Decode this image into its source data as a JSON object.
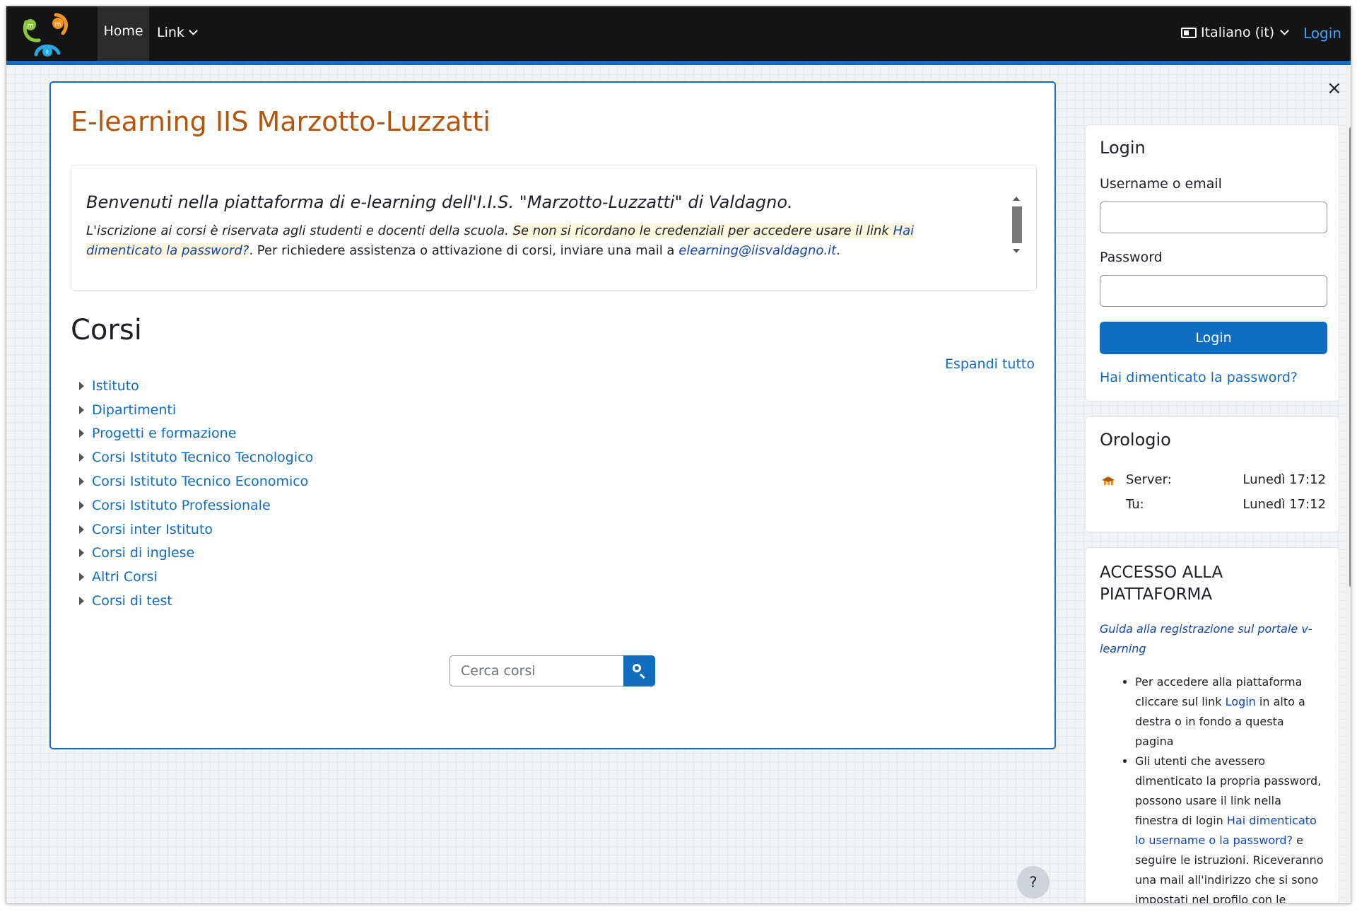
{
  "navbar": {
    "home": "Home",
    "link": "Link",
    "language": "Italiano (it)",
    "login": "Login",
    "logo_letters": [
      "m",
      "m",
      "it"
    ],
    "accent_color": "#0f6cbf"
  },
  "main": {
    "site_title": "E-learning IIS Marzotto-Luzzatti",
    "welcome": {
      "heading": "Benvenuti nella piattaforma di e-learning dell'I.I.S. \"Marzotto-Luzzatti\" di Valdagno.",
      "line1": "L'iscrizione ai corsi è riservata agli studenti e docenti della scuola.",
      "line2": "Se non si ricordano le credenziali per accedere usare il link",
      "forgot_link": "Hai dimenticato la password?",
      "line3": ". Per richiedere assistenza o attivazione di corsi, inviare una mail a",
      "email": "elearning@iisvaldagno.it",
      "line4": "."
    },
    "courses_heading": "Corsi",
    "expand_all": "Espandi tutto",
    "categories": [
      "Istituto",
      "Dipartimenti",
      "Progetti e formazione",
      "Corsi Istituto Tecnico Tecnologico",
      "Corsi Istituto Tecnico Economico",
      "Corsi Istituto Professionale",
      "Corsi inter Istituto",
      "Corsi di inglese",
      "Altri Corsi",
      "Corsi di test"
    ],
    "search_placeholder": "Cerca corsi"
  },
  "close_label": "×",
  "login_block": {
    "title": "Login",
    "username_label": "Username o email",
    "password_label": "Password",
    "button": "Login",
    "forgot": "Hai dimenticato la password?"
  },
  "clock_block": {
    "title": "Orologio",
    "server_label": "Server:",
    "server_time": "Lunedì 17:12",
    "you_label": "Tu:",
    "you_time": "Lunedì 17:12"
  },
  "access_block": {
    "title": "ACCESSO ALLA PIATTAFORMA",
    "guide_link": "Guida alla registrazione sul portale v-learning",
    "item1_a": "Per accedere alla piattaforma cliccare sul link",
    "item1_link": "Login",
    "item1_b": "in alto a destra o in fondo a questa pagina",
    "item2_a": "Gli utenti che avessero dimenticato la propria password, possono usare il link nella finestra di login",
    "item2_link": "Hai dimenticato lo username o la password?",
    "item2_b": "e seguire le istruzioni. Riceveranno una mail all'indirizzo che si sono impostati nel profilo con le indicazioni per il reset della password."
  },
  "help_label": "?"
}
